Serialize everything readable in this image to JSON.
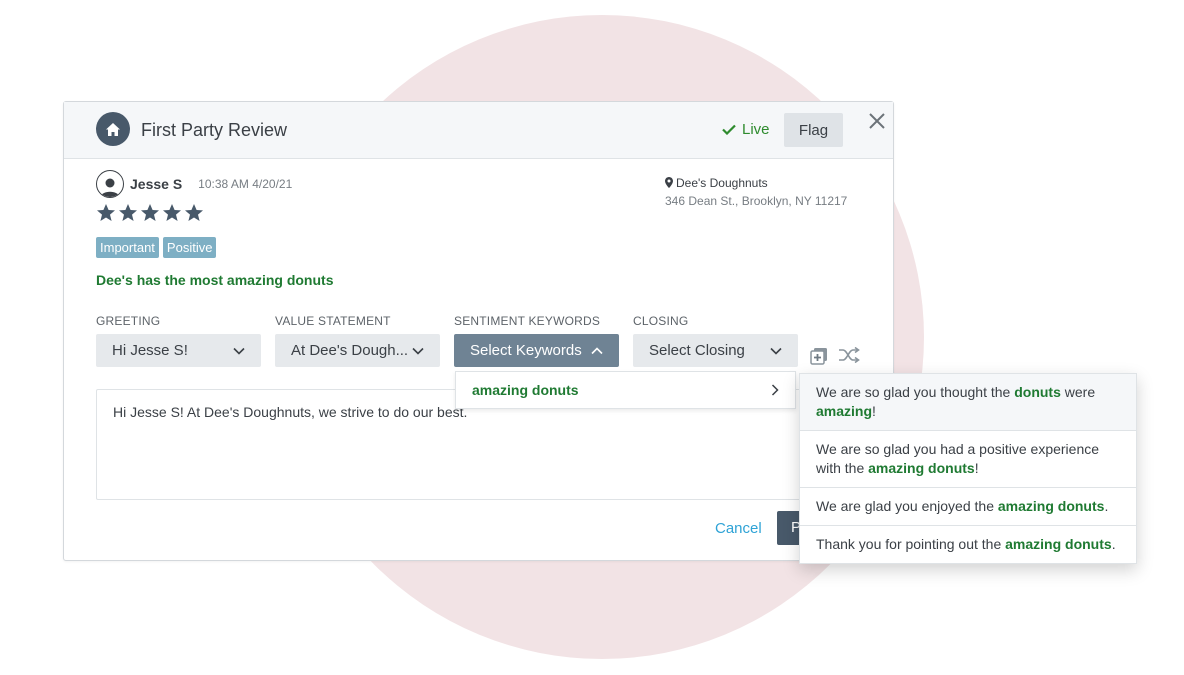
{
  "header": {
    "title": "First Party Review",
    "status": "Live",
    "flag_label": "Flag"
  },
  "review": {
    "reviewer_name": "Jesse S",
    "timestamp": "10:38 AM 4/20/21",
    "rating": 5,
    "location_name": "Dee's Doughnuts",
    "location_address": "346 Dean St., Brooklyn, NY 11217",
    "tags": [
      "Important",
      "Positive"
    ],
    "text": "Dee's has the most amazing donuts"
  },
  "composer": {
    "greeting": {
      "label": "GREETING",
      "value": "Hi Jesse S!"
    },
    "value_statement": {
      "label": "VALUE STATEMENT",
      "value": "At Dee's Dough..."
    },
    "sentiment": {
      "label": "SENTIMENT KEYWORDS",
      "value": "Select Keywords"
    },
    "closing": {
      "label": "CLOSING",
      "value": "Select Closing"
    },
    "keyword_options": [
      "amazing donuts"
    ],
    "response_text": "Hi Jesse S! At Dee's Doughnuts, we strive to do our best.",
    "cancel_label": "Cancel",
    "primary_label": "P"
  },
  "suggestions": [
    {
      "parts": [
        [
          "We are so glad you thought the ",
          false
        ],
        [
          "donuts",
          true
        ],
        [
          " were ",
          false
        ],
        [
          "amazing",
          true
        ],
        [
          "!",
          false
        ]
      ]
    },
    {
      "parts": [
        [
          "We are so glad you had a positive experience with the ",
          false
        ],
        [
          "amazing donuts",
          true
        ],
        [
          "!",
          false
        ]
      ]
    },
    {
      "parts": [
        [
          "We are glad you enjoyed the ",
          false
        ],
        [
          "amazing donuts",
          true
        ],
        [
          ".",
          false
        ]
      ]
    },
    {
      "parts": [
        [
          "Thank you for pointing out the ",
          false
        ],
        [
          "amazing donuts",
          true
        ],
        [
          ".",
          false
        ]
      ]
    }
  ],
  "colors": {
    "accent_green": "#1f7a32",
    "live_green": "#2e8b2e",
    "link_blue": "#2fa3d6",
    "tag_blue": "#7eafc4",
    "dark_slate": "#48596a"
  },
  "icons": {
    "home": "home-icon",
    "live": "check-icon",
    "close": "close-icon",
    "avatar": "user-icon",
    "star": "star-icon",
    "location": "map-pin-icon",
    "add": "add-template-icon",
    "shuffle": "shuffle-icon"
  }
}
